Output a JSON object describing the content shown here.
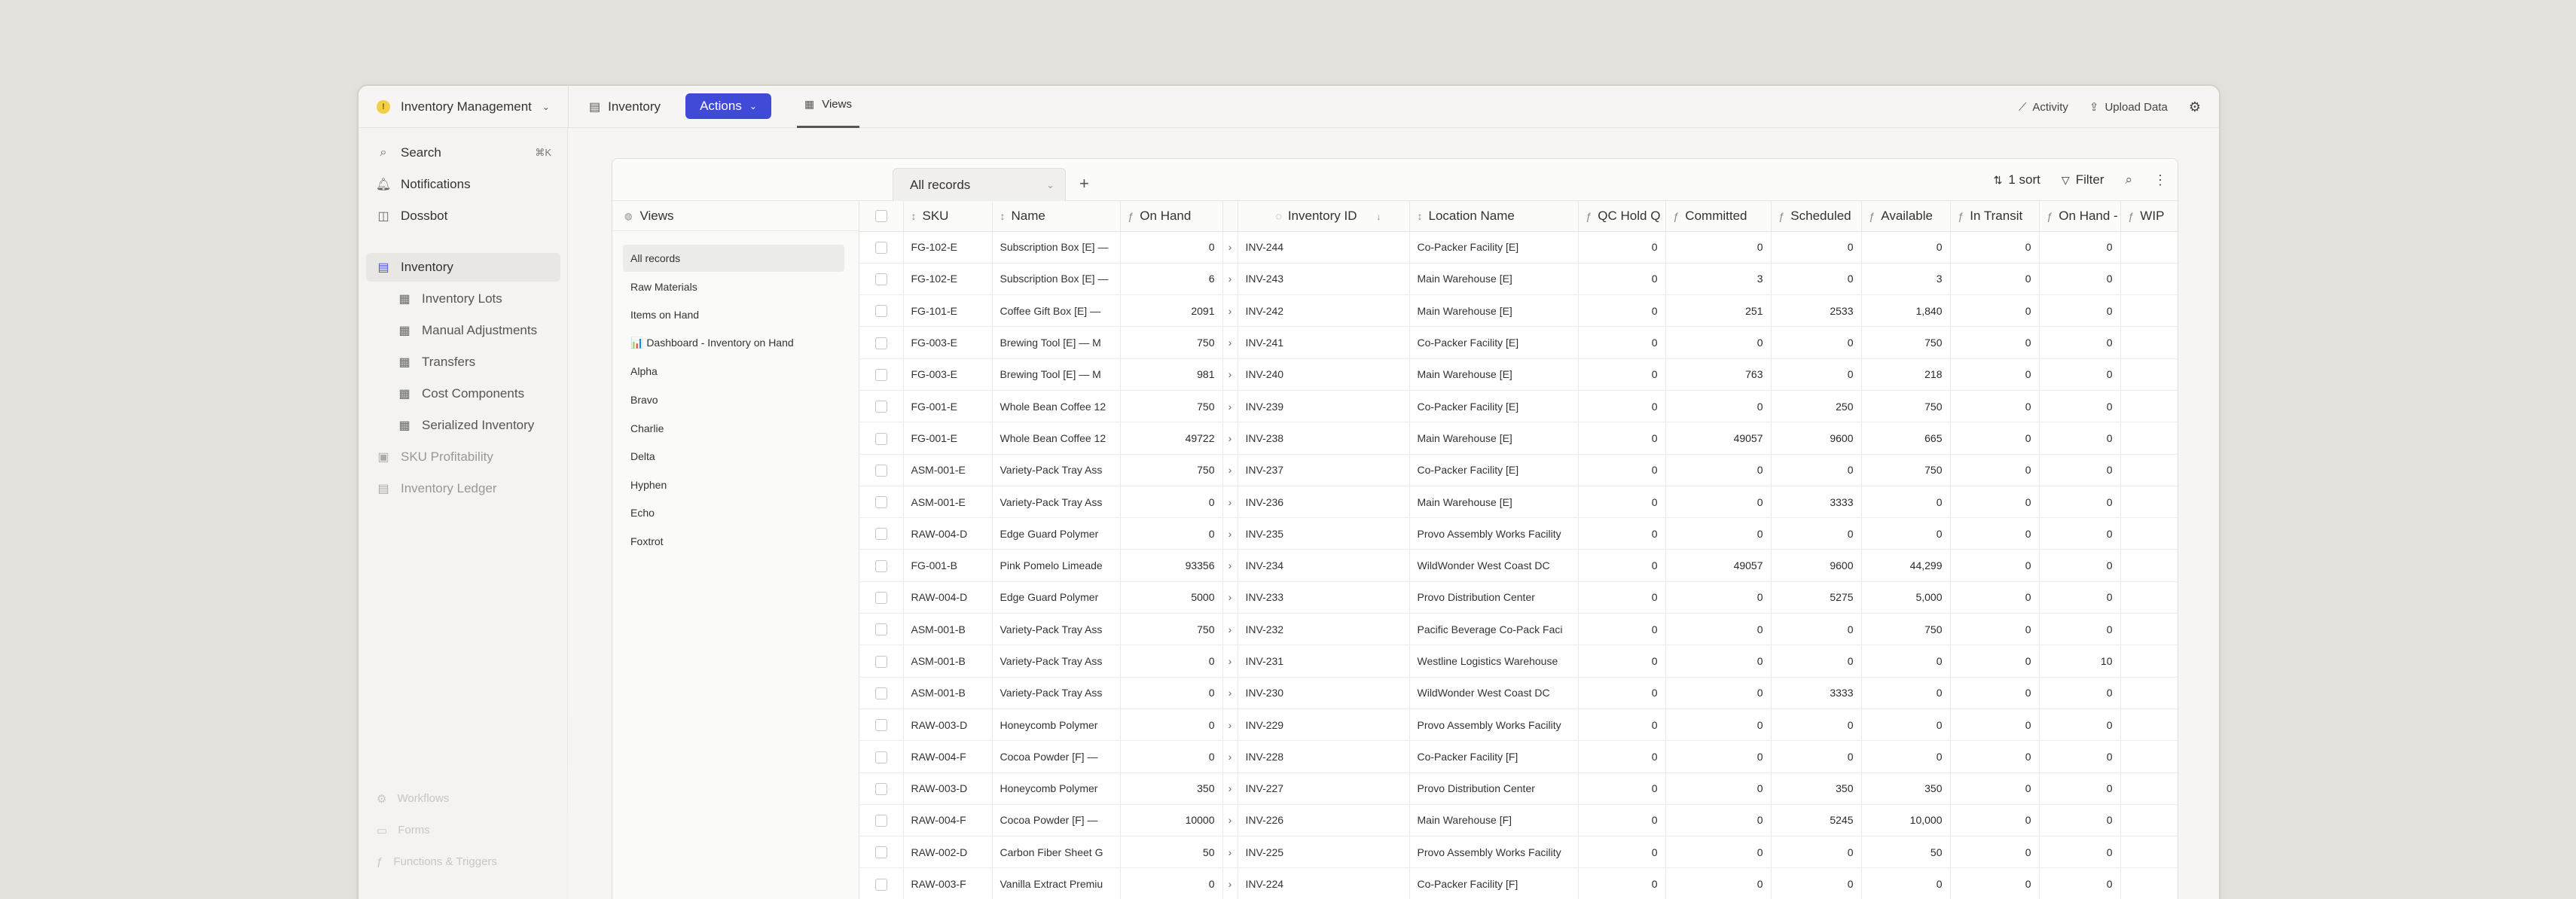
{
  "topbar": {
    "app_name": "Inventory Management",
    "inventory_label": "Inventory",
    "actions_label": "Actions",
    "views_label": "Views",
    "activity_label": "Activity",
    "upload_label": "Upload Data"
  },
  "sidebar": {
    "search_label": "Search",
    "search_shortcut": "⌘K",
    "notifications_label": "Notifications",
    "dossbot_label": "Dossbot",
    "items": [
      {
        "label": "Inventory"
      },
      {
        "label": "Inventory Lots"
      },
      {
        "label": "Manual Adjustments"
      },
      {
        "label": "Transfers"
      },
      {
        "label": "Cost Components"
      },
      {
        "label": "Serialized Inventory"
      },
      {
        "label": "SKU Profitability"
      },
      {
        "label": "Inventory Ledger"
      }
    ],
    "ghost": [
      "Workflows",
      "Forms",
      "Functions & Triggers"
    ]
  },
  "panel": {
    "tab_label": "All records",
    "sort_label": "1 sort",
    "filter_label": "Filter"
  },
  "views_pane": {
    "title": "Views",
    "items": [
      "All records",
      "Raw Materials",
      "Items on Hand",
      "📊 Dashboard - Inventory on Hand",
      "Alpha",
      "Bravo",
      "Charlie",
      "Delta",
      "Hyphen",
      "Echo",
      "Foxtrot"
    ]
  },
  "table": {
    "columns": [
      "SKU",
      "Name",
      "On Hand",
      "Inventory ID",
      "Location Name",
      "QC Hold Q",
      "Committed",
      "Scheduled",
      "Available",
      "In Transit",
      "On Hand -",
      "WIP"
    ],
    "rows": [
      [
        "FG-102-E",
        "Subscription Box [E] —",
        "0",
        "INV-244",
        "Co-Packer Facility [E]",
        "0",
        "0",
        "0",
        "0",
        "0",
        "0",
        ""
      ],
      [
        "FG-102-E",
        "Subscription Box [E] —",
        "6",
        "INV-243",
        "Main Warehouse [E]",
        "0",
        "3",
        "0",
        "3",
        "0",
        "0",
        ""
      ],
      [
        "FG-101-E",
        "Coffee Gift Box [E] —",
        "2091",
        "INV-242",
        "Main Warehouse [E]",
        "0",
        "251",
        "2533",
        "1,840",
        "0",
        "0",
        ""
      ],
      [
        "FG-003-E",
        "Brewing Tool [E] — M",
        "750",
        "INV-241",
        "Co-Packer Facility [E]",
        "0",
        "0",
        "0",
        "750",
        "0",
        "0",
        ""
      ],
      [
        "FG-003-E",
        "Brewing Tool [E] — M",
        "981",
        "INV-240",
        "Main Warehouse [E]",
        "0",
        "763",
        "0",
        "218",
        "0",
        "0",
        ""
      ],
      [
        "FG-001-E",
        "Whole Bean Coffee 12",
        "750",
        "INV-239",
        "Co-Packer Facility [E]",
        "0",
        "0",
        "250",
        "750",
        "0",
        "0",
        ""
      ],
      [
        "FG-001-E",
        "Whole Bean Coffee 12",
        "49722",
        "INV-238",
        "Main Warehouse [E]",
        "0",
        "49057",
        "9600",
        "665",
        "0",
        "0",
        ""
      ],
      [
        "ASM-001-E",
        "Variety-Pack Tray Ass",
        "750",
        "INV-237",
        "Co-Packer Facility [E]",
        "0",
        "0",
        "0",
        "750",
        "0",
        "0",
        ""
      ],
      [
        "ASM-001-E",
        "Variety-Pack Tray Ass",
        "0",
        "INV-236",
        "Main Warehouse [E]",
        "0",
        "0",
        "3333",
        "0",
        "0",
        "0",
        ""
      ],
      [
        "RAW-004-D",
        "Edge Guard Polymer",
        "0",
        "INV-235",
        "Provo Assembly Works Facility",
        "0",
        "0",
        "0",
        "0",
        "0",
        "0",
        ""
      ],
      [
        "FG-001-B",
        "Pink Pomelo Limeade",
        "93356",
        "INV-234",
        "WildWonder West Coast DC",
        "0",
        "49057",
        "9600",
        "44,299",
        "0",
        "0",
        ""
      ],
      [
        "RAW-004-D",
        "Edge Guard Polymer",
        "5000",
        "INV-233",
        "Provo Distribution Center",
        "0",
        "0",
        "5275",
        "5,000",
        "0",
        "0",
        ""
      ],
      [
        "ASM-001-B",
        "Variety-Pack Tray Ass",
        "750",
        "INV-232",
        "Pacific Beverage Co-Pack Faci",
        "0",
        "0",
        "0",
        "750",
        "0",
        "0",
        ""
      ],
      [
        "ASM-001-B",
        "Variety-Pack Tray Ass",
        "0",
        "INV-231",
        "Westline Logistics Warehouse",
        "0",
        "0",
        "0",
        "0",
        "0",
        "10",
        ""
      ],
      [
        "ASM-001-B",
        "Variety-Pack Tray Ass",
        "0",
        "INV-230",
        "WildWonder West Coast DC",
        "0",
        "0",
        "3333",
        "0",
        "0",
        "0",
        ""
      ],
      [
        "RAW-003-D",
        "Honeycomb Polymer",
        "0",
        "INV-229",
        "Provo Assembly Works Facility",
        "0",
        "0",
        "0",
        "0",
        "0",
        "0",
        ""
      ],
      [
        "RAW-004-F",
        "Cocoa Powder [F] — ",
        "0",
        "INV-228",
        "Co-Packer Facility [F]",
        "0",
        "0",
        "0",
        "0",
        "0",
        "0",
        ""
      ],
      [
        "RAW-003-D",
        "Honeycomb Polymer",
        "350",
        "INV-227",
        "Provo Distribution Center",
        "0",
        "0",
        "350",
        "350",
        "0",
        "0",
        ""
      ],
      [
        "RAW-004-F",
        "Cocoa Powder [F] — ",
        "10000",
        "INV-226",
        "Main Warehouse [F]",
        "0",
        "0",
        "5245",
        "10,000",
        "0",
        "0",
        ""
      ],
      [
        "RAW-002-D",
        "Carbon Fiber Sheet G",
        "50",
        "INV-225",
        "Provo Assembly Works Facility",
        "0",
        "0",
        "0",
        "50",
        "0",
        "0",
        ""
      ],
      [
        "RAW-003-F",
        "Vanilla Extract Premiu",
        "0",
        "INV-224",
        "Co-Packer Facility [F]",
        "0",
        "0",
        "0",
        "0",
        "0",
        "0",
        ""
      ]
    ]
  },
  "colors": {
    "accent": "#3f4ad6",
    "background": "#e5e2dd"
  }
}
